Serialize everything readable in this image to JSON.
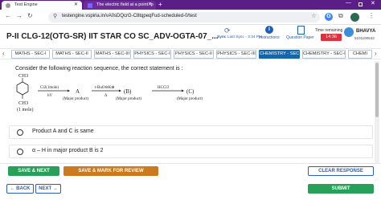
{
  "browser": {
    "tabs": [
      {
        "title": "Test Engine",
        "active": true
      },
      {
        "title": "The electric field at a point \"p",
        "active": false
      }
    ],
    "new_tab_icon": "+",
    "url": "testengine.vspiria.in/vA0sDQcrG-C8tqpeqFud-scheduled-0/test"
  },
  "header": {
    "test_title": "P-II CLG-12(OTG-SR) IIT STAR CO SC_ADV-OGTA-07_...",
    "sync_label": "Sync",
    "sync_time": "Last Sync - 3:34 PM",
    "instructions_label": "Instructions",
    "question_paper_label": "Question Paper",
    "time_remaining_label": "Time remaining",
    "timer": "14:36",
    "username": "BHAVYA",
    "userid": "5101100543"
  },
  "sections": [
    {
      "label": "MATHS - SEC-I",
      "active": false
    },
    {
      "label": "MATHS - SEC-II",
      "active": false
    },
    {
      "label": "MATHS - SEC-III",
      "active": false
    },
    {
      "label": "PHYSICS - SEC-I",
      "active": false
    },
    {
      "label": "PHYSICS - SEC-II",
      "active": false
    },
    {
      "label": "PHYSICS - SEC-III",
      "active": false
    },
    {
      "label": "CHEMISTRY - SEC-I",
      "active": true
    },
    {
      "label": "CHEMISTRY - SEC-II",
      "active": false
    },
    {
      "label": "CHEMI",
      "active": false
    }
  ],
  "question": {
    "text": "Consider the following reaction sequence, the correct statement is :",
    "scheme": {
      "reactant_top": "CH3",
      "reactant_bottom": "CH3",
      "reactant_note": "(1 mole)",
      "reagent1_top": "Cl2(1mole)",
      "reagent1_bottom": "hV",
      "product_A": "A",
      "product_A_note": "(Major product)",
      "reagent2_top": "t-BuO⊖K⊕",
      "reagent2_bottom": "Δ",
      "product_B": "(B)",
      "product_B_note": "(Major product)",
      "reagent3_top": "HCCl3",
      "reagent3_bottom": "",
      "product_C": "(C)",
      "product_C_note": "(Major product)"
    },
    "options": [
      {
        "text": "Product A and C is same"
      },
      {
        "text": "α – H  in major product B is 2"
      }
    ]
  },
  "footer": {
    "save_next": "SAVE & NEXT",
    "save_mark_review": "SAVE & MARK FOR REVIEW",
    "clear_response": "CLEAR RESPONSE",
    "back": "← BACK",
    "next": "NEXT →",
    "submit": "SUBMIT"
  },
  "colors": {
    "browser_frame": "#5b1d86",
    "active_section": "#1565a8",
    "save_next": "#27a05a",
    "save_mark_review": "#cc7a1e",
    "timer": "#e0303c",
    "link_blue": "#2b5fb5"
  }
}
